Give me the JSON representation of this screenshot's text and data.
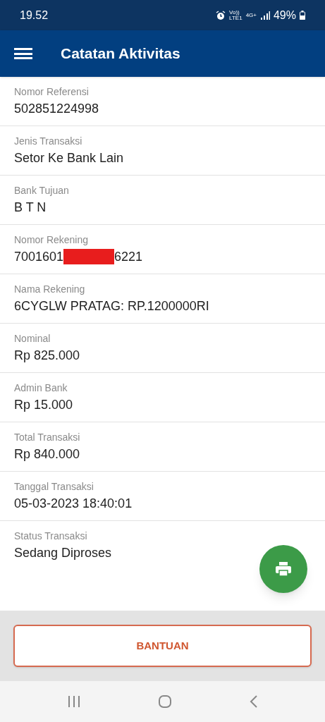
{
  "status_bar": {
    "time": "19.52",
    "volte": "Vo))",
    "lte": "LTE1",
    "network": "4G+",
    "battery": "49%"
  },
  "app_bar": {
    "title": "Catatan Aktivitas"
  },
  "fields": [
    {
      "label": "Nomor Referensi",
      "value": "502851224998"
    },
    {
      "label": "Jenis Transaksi",
      "value": "Setor Ke Bank Lain"
    },
    {
      "label": "Bank Tujuan",
      "value": "B T N"
    },
    {
      "label": "Nomor Rekening",
      "value": "7001601",
      "value_end": "6221",
      "redacted": true
    },
    {
      "label": "Nama Rekening",
      "value": "6CYGLW PRATAG: RP.1200000RI"
    },
    {
      "label": "Nominal",
      "value": "Rp 825.000"
    },
    {
      "label": "Admin Bank",
      "value": "Rp 15.000"
    },
    {
      "label": "Total Transaksi",
      "value": "Rp 840.000"
    },
    {
      "label": "Tanggal Transaksi",
      "value": "05-03-2023 18:40:01"
    },
    {
      "label": "Status Transaksi",
      "value": "Sedang Diproses"
    }
  ],
  "help_button": {
    "label": "BANTUAN"
  }
}
